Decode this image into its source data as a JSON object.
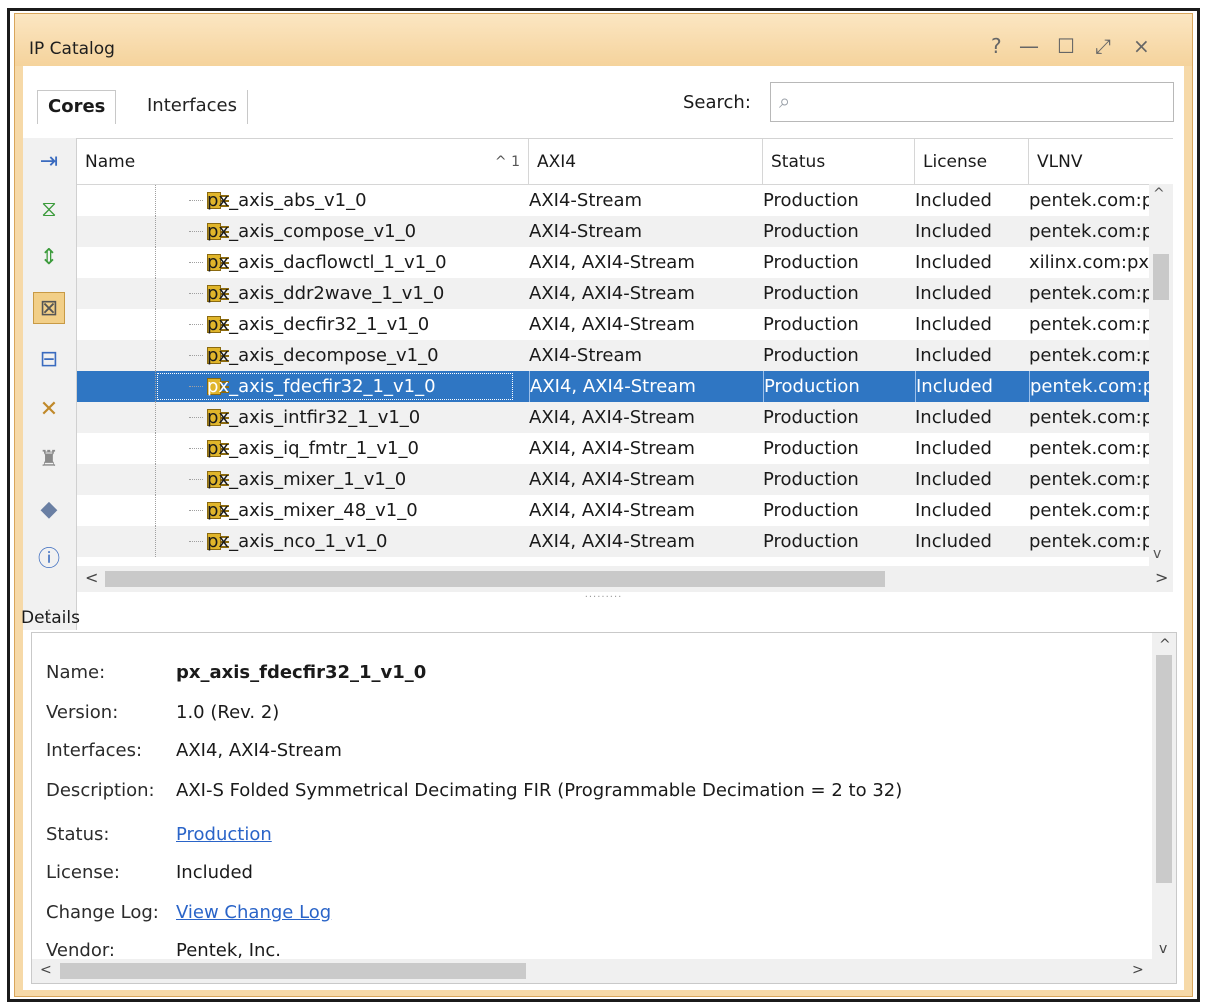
{
  "window": {
    "title": "IP Catalog",
    "controls": [
      "?",
      "—",
      "☐",
      "⤢",
      "×"
    ]
  },
  "tabs": {
    "cores": "Cores",
    "interfaces": "Interfaces"
  },
  "search": {
    "label": "Search:",
    "placeholder": ""
  },
  "toolbar": {
    "icons": [
      "collapse-all-icon",
      "expand-all-icon",
      "expand-selected-icon",
      "filter-icon",
      "group-icon",
      "customize-ip-icon",
      "repository-icon",
      "tag-icon",
      "info-icon"
    ]
  },
  "table": {
    "columns": [
      "Name",
      "AXI4",
      "Status",
      "License",
      "VLNV"
    ],
    "sort_indicator": "^ 1",
    "rows": [
      {
        "name": "px_axis_abs_v1_0",
        "axi": "AXI4-Stream",
        "status": "Production",
        "license": "Included",
        "vlnv": "pentek.com:p"
      },
      {
        "name": "px_axis_compose_v1_0",
        "axi": "AXI4-Stream",
        "status": "Production",
        "license": "Included",
        "vlnv": "pentek.com:p"
      },
      {
        "name": "px_axis_dacflowctl_1_v1_0",
        "axi": "AXI4, AXI4-Stream",
        "status": "Production",
        "license": "Included",
        "vlnv": "xilinx.com:px"
      },
      {
        "name": "px_axis_ddr2wave_1_v1_0",
        "axi": "AXI4, AXI4-Stream",
        "status": "Production",
        "license": "Included",
        "vlnv": "pentek.com:p"
      },
      {
        "name": "px_axis_decfir32_1_v1_0",
        "axi": "AXI4, AXI4-Stream",
        "status": "Production",
        "license": "Included",
        "vlnv": "pentek.com:p"
      },
      {
        "name": "px_axis_decompose_v1_0",
        "axi": "AXI4-Stream",
        "status": "Production",
        "license": "Included",
        "vlnv": "pentek.com:p"
      },
      {
        "name": "px_axis_fdecfir32_1_v1_0",
        "axi": "AXI4, AXI4-Stream",
        "status": "Production",
        "license": "Included",
        "vlnv": "pentek.com:p"
      },
      {
        "name": "px_axis_intfir32_1_v1_0",
        "axi": "AXI4, AXI4-Stream",
        "status": "Production",
        "license": "Included",
        "vlnv": "pentek.com:p"
      },
      {
        "name": "px_axis_iq_fmtr_1_v1_0",
        "axi": "AXI4, AXI4-Stream",
        "status": "Production",
        "license": "Included",
        "vlnv": "pentek.com:p"
      },
      {
        "name": "px_axis_mixer_1_v1_0",
        "axi": "AXI4, AXI4-Stream",
        "status": "Production",
        "license": "Included",
        "vlnv": "pentek.com:p"
      },
      {
        "name": "px_axis_mixer_48_v1_0",
        "axi": "AXI4, AXI4-Stream",
        "status": "Production",
        "license": "Included",
        "vlnv": "pentek.com:p"
      },
      {
        "name": "px_axis_nco_1_v1_0",
        "axi": "AXI4, AXI4-Stream",
        "status": "Production",
        "license": "Included",
        "vlnv": "pentek.com:p"
      }
    ],
    "selected_index": 6
  },
  "details": {
    "label": "Details",
    "fields": [
      {
        "key": "Name:",
        "value": "px_axis_fdecfir32_1_v1_0",
        "style": "bold"
      },
      {
        "key": "Version:",
        "value": "1.0 (Rev. 2)",
        "style": ""
      },
      {
        "key": "Interfaces:",
        "value": "AXI4, AXI4-Stream",
        "style": ""
      },
      {
        "key": "Description:",
        "value": "AXI-S Folded Symmetrical Decimating FIR (Programmable Decimation = 2 to 32)",
        "style": ""
      },
      {
        "key": "Status:",
        "value": "Production",
        "style": "link"
      },
      {
        "key": "License:",
        "value": "Included",
        "style": ""
      },
      {
        "key": "Change Log:",
        "value": "View Change Log",
        "style": "link"
      },
      {
        "key": "Vendor:",
        "value": "Pentek, Inc.",
        "style": ""
      }
    ]
  },
  "splitter_grip": "·········",
  "scroll_arrows": {
    "up": "^",
    "down": "v",
    "left": "<",
    "right": ">"
  }
}
